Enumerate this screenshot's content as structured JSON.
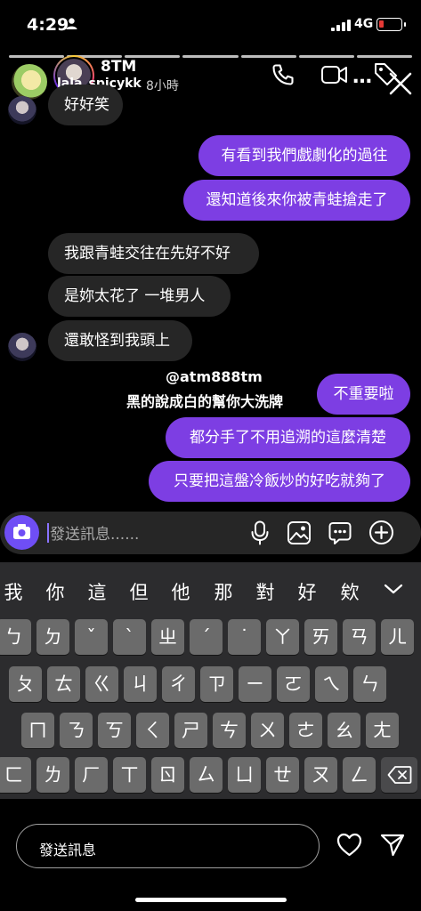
{
  "status_bar": {
    "time": "4:29",
    "network": "4G"
  },
  "story_header": {
    "name": "8TM",
    "username": "lala_spicykk",
    "time_ago": "8小時"
  },
  "messages": [
    {
      "side": "in",
      "text": "好好笑"
    },
    {
      "side": "out",
      "text": "有看到我們戲劇化的過往"
    },
    {
      "side": "out",
      "text": "還知道後來你被青蛙搶走了"
    },
    {
      "side": "in",
      "text": "我跟青蛙交往在先好不好"
    },
    {
      "side": "in",
      "text": "是妳太花了 一堆男人"
    },
    {
      "side": "in",
      "text": "還敢怪到我頭上"
    },
    {
      "side": "out",
      "text": "不重要啦"
    },
    {
      "side": "out",
      "text": "都分手了不用追溯的這麼清楚"
    },
    {
      "side": "out",
      "text": "只要把這盤冷飯炒的好吃就夠了"
    }
  ],
  "sticker": {
    "username": "@atm888tm",
    "text": "黑的說成白的幫你大洗牌"
  },
  "composer": {
    "placeholder": "發送訊息......"
  },
  "keyboard": {
    "candidates": [
      "我",
      "你",
      "這",
      "但",
      "他",
      "那",
      "對",
      "好",
      "欸"
    ],
    "row1": [
      "ㄅ",
      "ㄉ",
      "ˇ",
      "ˋ",
      "ㄓ",
      "ˊ",
      "˙",
      "ㄚ",
      "ㄞ",
      "ㄢ",
      "ㄦ"
    ],
    "row2": [
      "ㄆ",
      "ㄊ",
      "ㄍ",
      "ㄐ",
      "ㄔ",
      "ㄗ",
      "ㄧ",
      "ㄛ",
      "ㄟ",
      "ㄣ"
    ],
    "row3": [
      "ㄇ",
      "ㄋ",
      "ㄎ",
      "ㄑ",
      "ㄕ",
      "ㄘ",
      "ㄨ",
      "ㄜ",
      "ㄠ",
      "ㄤ"
    ],
    "row4": [
      "ㄈ",
      "ㄌ",
      "ㄏ",
      "ㄒ",
      "ㄖ",
      "ㄙ",
      "ㄩ",
      "ㄝ",
      "ㄡ",
      "ㄥ"
    ]
  },
  "story_reply": {
    "placeholder": "發送訊息"
  },
  "colors": {
    "outgoing_bubble": "#7d3ee3",
    "incoming_bubble": "#262626",
    "camera_button": "#6f4ef5"
  }
}
